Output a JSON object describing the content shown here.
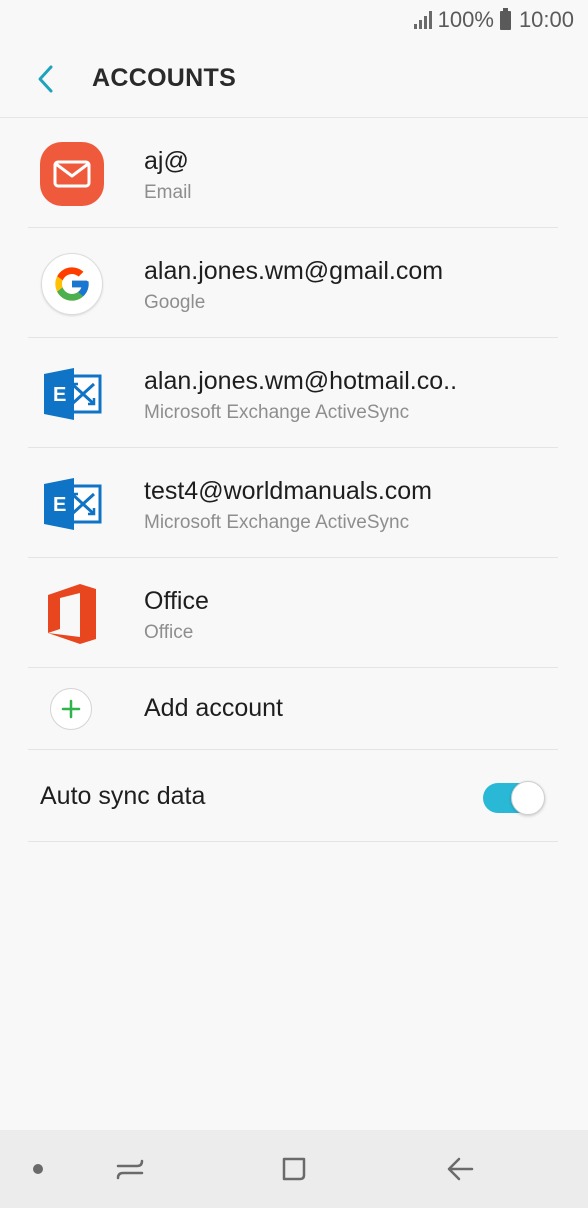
{
  "status_bar": {
    "battery_text": "100%",
    "time": "10:00",
    "icons": [
      "signal-icon",
      "battery-icon"
    ]
  },
  "header": {
    "title": "ACCOUNTS",
    "back_icon": "chevron-left-icon"
  },
  "accounts": [
    {
      "name": "aj@",
      "type": "Email",
      "icon": "email-app-icon"
    },
    {
      "name": "alan.jones.wm@gmail.com",
      "type": "Google",
      "icon": "google-icon"
    },
    {
      "name": "alan.jones.wm@hotmail.co..",
      "type": "Microsoft Exchange ActiveSync",
      "icon": "exchange-icon"
    },
    {
      "name": "test4@worldmanuals.com",
      "type": "Microsoft Exchange ActiveSync",
      "icon": "exchange-icon"
    },
    {
      "name": "Office",
      "type": "Office",
      "icon": "office-icon"
    }
  ],
  "add_account": {
    "label": "Add account",
    "icon": "plus-icon"
  },
  "auto_sync": {
    "label": "Auto sync data",
    "enabled": true
  },
  "nav_bar": {
    "icons": [
      "dot-icon",
      "recents-icon",
      "home-icon",
      "back-icon"
    ]
  },
  "colors": {
    "accent": "#29b9d7",
    "back_chevron": "#1fa3bd",
    "email_icon": "#f05a3c",
    "exchange_blue": "#0f73c6",
    "office_red": "#e8461f",
    "plus_green": "#2fb34a"
  }
}
